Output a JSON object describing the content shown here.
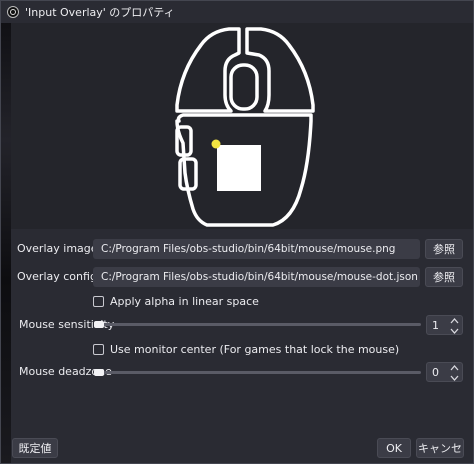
{
  "window": {
    "title": "'Input Overlay' のプロパティ",
    "title_icon": "obs-logo-icon"
  },
  "preview": {
    "description_icon": "mouse-overlay-preview",
    "cursor_dot_color": "#f5e642",
    "outline_color": "#ffffff"
  },
  "fields": {
    "overlay_image": {
      "label": "Overlay image file",
      "value": "C:/Program Files/obs-studio/bin/64bit/mouse/mouse.png",
      "browse_label": "参照"
    },
    "overlay_config": {
      "label": "Overlay config file",
      "value": "C:/Program Files/obs-studio/bin/64bit/mouse/mouse-dot.json",
      "browse_label": "参照"
    }
  },
  "apply_alpha": {
    "label": "Apply alpha in linear space",
    "checked": false
  },
  "mouse_sensitivity": {
    "label": "Mouse sensitivity",
    "value": "1",
    "slider_fraction": 0.0
  },
  "monitor_center": {
    "label": "Use monitor center (For games that lock the mouse)",
    "checked": false
  },
  "mouse_deadzone": {
    "label": "Mouse deadzone",
    "value": "0",
    "slider_fraction": 0.0
  },
  "footer": {
    "defaults_label": "既定値",
    "ok_label": "OK",
    "cancel_label": "キャンセル"
  }
}
